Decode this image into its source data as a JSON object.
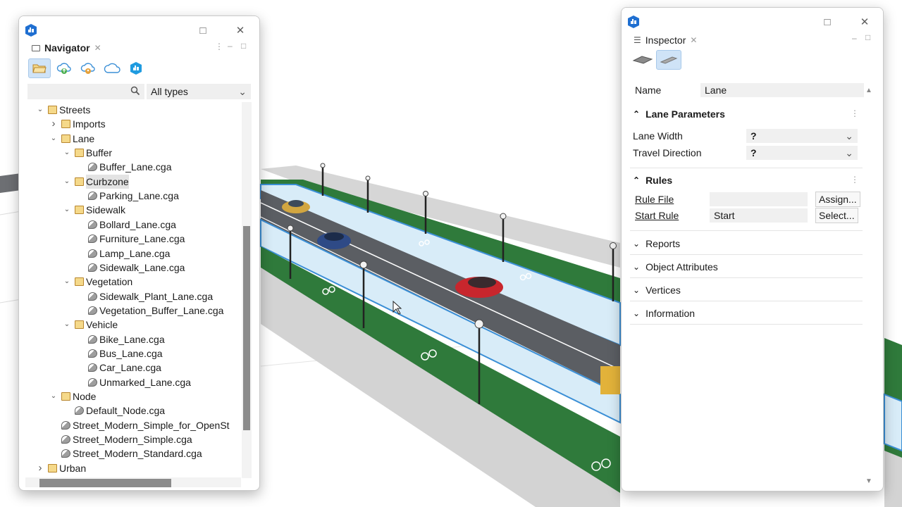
{
  "navigator": {
    "tab_label": "Navigator",
    "tools": [
      "open-folder-icon",
      "cloud-upload-icon",
      "cloud-share-icon",
      "cloud-icon",
      "cityengine-icon"
    ],
    "search_placeholder": "",
    "type_filter": "All types",
    "tree": [
      {
        "label": "Streets",
        "kind": "folder",
        "expanded": true,
        "level": 0
      },
      {
        "label": "Imports",
        "kind": "folder",
        "expanded": false,
        "level": 1
      },
      {
        "label": "Lane",
        "kind": "folder",
        "expanded": true,
        "level": 1
      },
      {
        "label": "Buffer",
        "kind": "folder",
        "expanded": true,
        "level": 2
      },
      {
        "label": "Buffer_Lane.cga",
        "kind": "file",
        "level": 3
      },
      {
        "label": "Curbzone",
        "kind": "folder",
        "expanded": true,
        "level": 2,
        "selected": true
      },
      {
        "label": "Parking_Lane.cga",
        "kind": "file",
        "level": 3
      },
      {
        "label": "Sidewalk",
        "kind": "folder",
        "expanded": true,
        "level": 2
      },
      {
        "label": "Bollard_Lane.cga",
        "kind": "file",
        "level": 3
      },
      {
        "label": "Furniture_Lane.cga",
        "kind": "file",
        "level": 3
      },
      {
        "label": "Lamp_Lane.cga",
        "kind": "file",
        "level": 3
      },
      {
        "label": "Sidewalk_Lane.cga",
        "kind": "file",
        "level": 3
      },
      {
        "label": "Vegetation",
        "kind": "folder",
        "expanded": true,
        "level": 2
      },
      {
        "label": "Sidewalk_Plant_Lane.cga",
        "kind": "file",
        "level": 3
      },
      {
        "label": "Vegetation_Buffer_Lane.cga",
        "kind": "file",
        "level": 3
      },
      {
        "label": "Vehicle",
        "kind": "folder",
        "expanded": true,
        "level": 2
      },
      {
        "label": "Bike_Lane.cga",
        "kind": "file",
        "level": 3
      },
      {
        "label": "Bus_Lane.cga",
        "kind": "file",
        "level": 3
      },
      {
        "label": "Car_Lane.cga",
        "kind": "file",
        "level": 3
      },
      {
        "label": "Unmarked_Lane.cga",
        "kind": "file",
        "level": 3
      },
      {
        "label": "Node",
        "kind": "folder",
        "expanded": true,
        "level": 1
      },
      {
        "label": "Default_Node.cga",
        "kind": "file",
        "level": 2
      },
      {
        "label": "Street_Modern_Simple_for_OpenSt",
        "kind": "file",
        "level": 1
      },
      {
        "label": "Street_Modern_Simple.cga",
        "kind": "file",
        "level": 1
      },
      {
        "label": "Street_Modern_Standard.cga",
        "kind": "file",
        "level": 1
      },
      {
        "label": "Urban",
        "kind": "folder",
        "expanded": false,
        "level": 0
      }
    ]
  },
  "inspector": {
    "tab_label": "Inspector",
    "name_label": "Name",
    "name_value": "Lane",
    "lane_params": {
      "title": "Lane Parameters",
      "fields": [
        {
          "label": "Lane Width",
          "value": "?"
        },
        {
          "label": "Travel Direction",
          "value": "?"
        }
      ]
    },
    "rules": {
      "title": "Rules",
      "rule_file_label": "Rule File",
      "rule_file_value": "",
      "assign_button": "Assign...",
      "start_rule_label": "Start Rule",
      "start_rule_value": "Start",
      "select_button": "Select..."
    },
    "collapsed_sections": [
      "Reports",
      "Object Attributes",
      "Vertices",
      "Information"
    ]
  },
  "colors": {
    "accent": "#1f6fd1",
    "selection": "#cfe3f7",
    "road": "#5b5e63",
    "bike_lane": "#d8ecf8",
    "green_lane": "#2f7a3b",
    "sidewalk": "#cfcfcf"
  }
}
